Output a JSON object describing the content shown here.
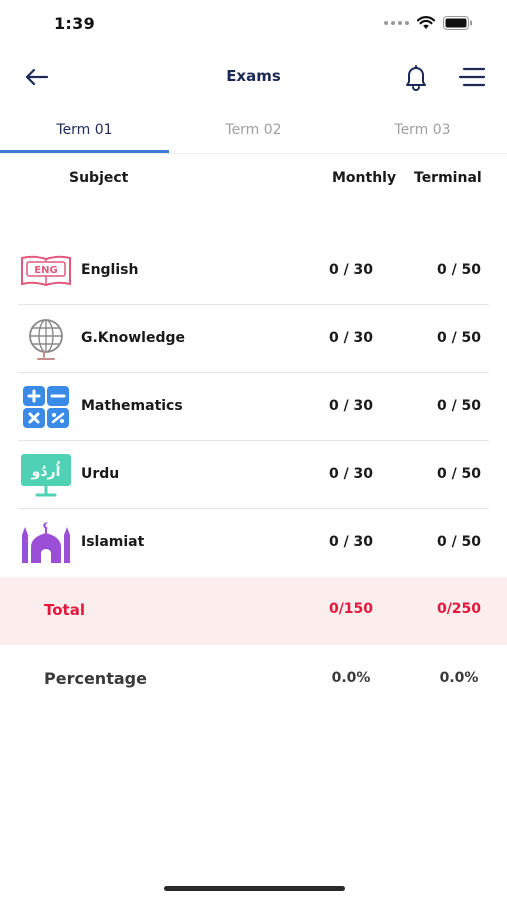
{
  "status_bar": {
    "time": "1:39"
  },
  "header": {
    "title": "Exams"
  },
  "tabs": [
    {
      "label": "Term 01",
      "active": true
    },
    {
      "label": "Term 02",
      "active": false
    },
    {
      "label": "Term 03",
      "active": false
    }
  ],
  "table": {
    "headers": {
      "subject": "Subject",
      "monthly": "Monthly",
      "terminal": "Terminal"
    },
    "rows": [
      {
        "subject": "English",
        "icon": "eng-book-icon",
        "icon_text": "ENG",
        "monthly": "0 / 30",
        "terminal": "0 / 50"
      },
      {
        "subject": "G.Knowledge",
        "icon": "globe-icon",
        "monthly": "0 / 30",
        "terminal": "0 / 50"
      },
      {
        "subject": "Mathematics",
        "icon": "calculator-icon",
        "monthly": "0 / 30",
        "terminal": "0 / 50"
      },
      {
        "subject": "Urdu",
        "icon": "urdu-board-icon",
        "icon_text": "اُردُو",
        "monthly": "0 / 30",
        "terminal": "0 / 50"
      },
      {
        "subject": "Islamiat",
        "icon": "mosque-icon",
        "monthly": "0 / 30",
        "terminal": "0 / 50"
      }
    ]
  },
  "total": {
    "label": "Total",
    "monthly": "0/150",
    "terminal": "0/250"
  },
  "percentage": {
    "label": "Percentage",
    "monthly": "0.0%",
    "terminal": "0.0%"
  },
  "colors": {
    "accent": "#3a7bd5",
    "title": "#1d2a57",
    "total_red": "#e4173e",
    "total_bg": "#fdeeee"
  }
}
